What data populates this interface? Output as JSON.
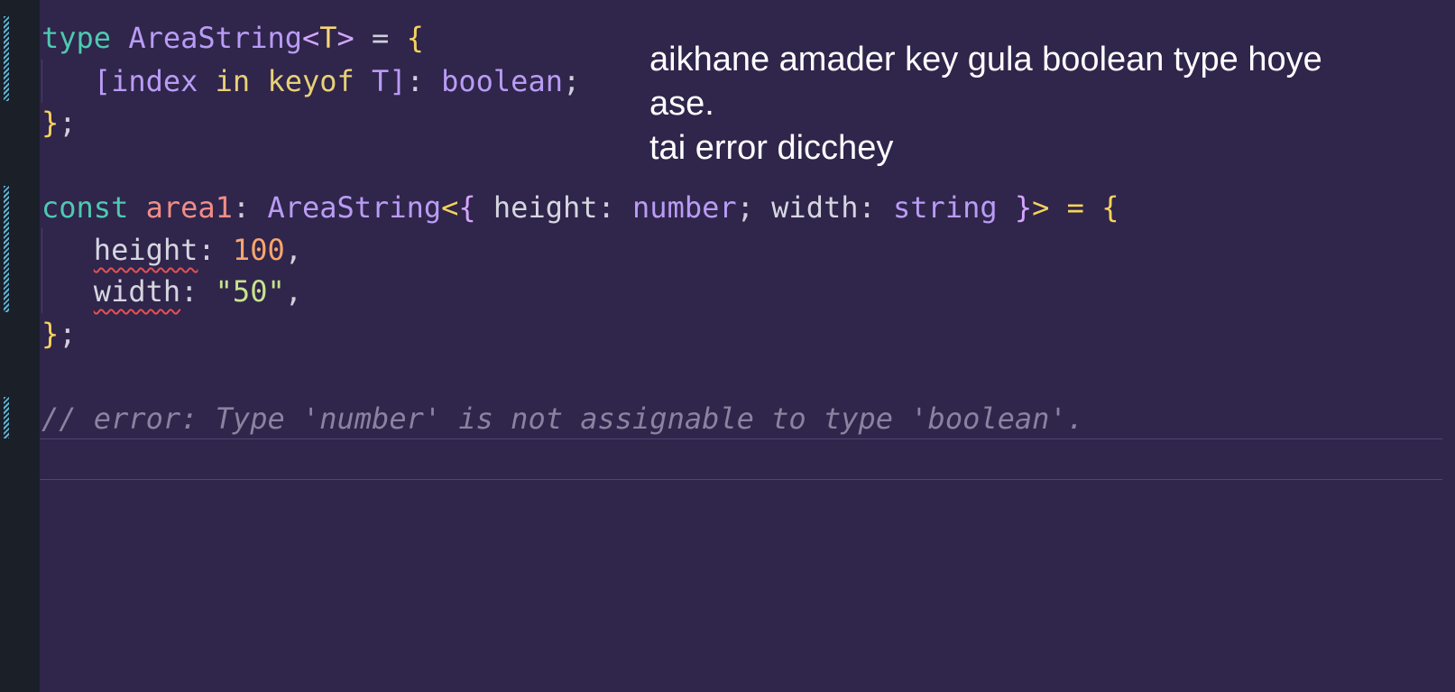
{
  "code": {
    "line1": {
      "kw": "type",
      "name": "AreaString",
      "lt": "<",
      "tparam": "T",
      "gt": ">",
      "eq": " = ",
      "open": "{"
    },
    "line2": {
      "lb": "[",
      "index": "index",
      "in": "in",
      "keyof": "keyof",
      "t": "T",
      "rb": "]",
      "colon": ": ",
      "type": "boolean",
      "semi": ";"
    },
    "line3": {
      "close": "}",
      "semi": ";"
    },
    "line5": {
      "kw": "const",
      "var": "area1",
      "colon": ": ",
      "name": "AreaString",
      "lt": "<",
      "ob": "{",
      "p1": "height",
      "c1": ": ",
      "t1": "number",
      "s1": "; ",
      "p2": "width",
      "c2": ": ",
      "t2": "string",
      "cb": "}",
      "gt": ">",
      "eq": " = ",
      "open": "{"
    },
    "line6": {
      "prop": "height",
      "colon": ": ",
      "value": "100",
      "comma": ","
    },
    "line7": {
      "prop": "width",
      "colon": ": ",
      "value": "\"50\"",
      "comma": ","
    },
    "line8": {
      "close": "}",
      "semi": ";"
    },
    "line10": {
      "comment": "// error: Type 'number' is not assignable to type 'boolean'."
    }
  },
  "annotation": {
    "line1": "aikhane amader key gula boolean type hoye",
    "line2": "ase.",
    "line3": "tai error dicchey"
  }
}
